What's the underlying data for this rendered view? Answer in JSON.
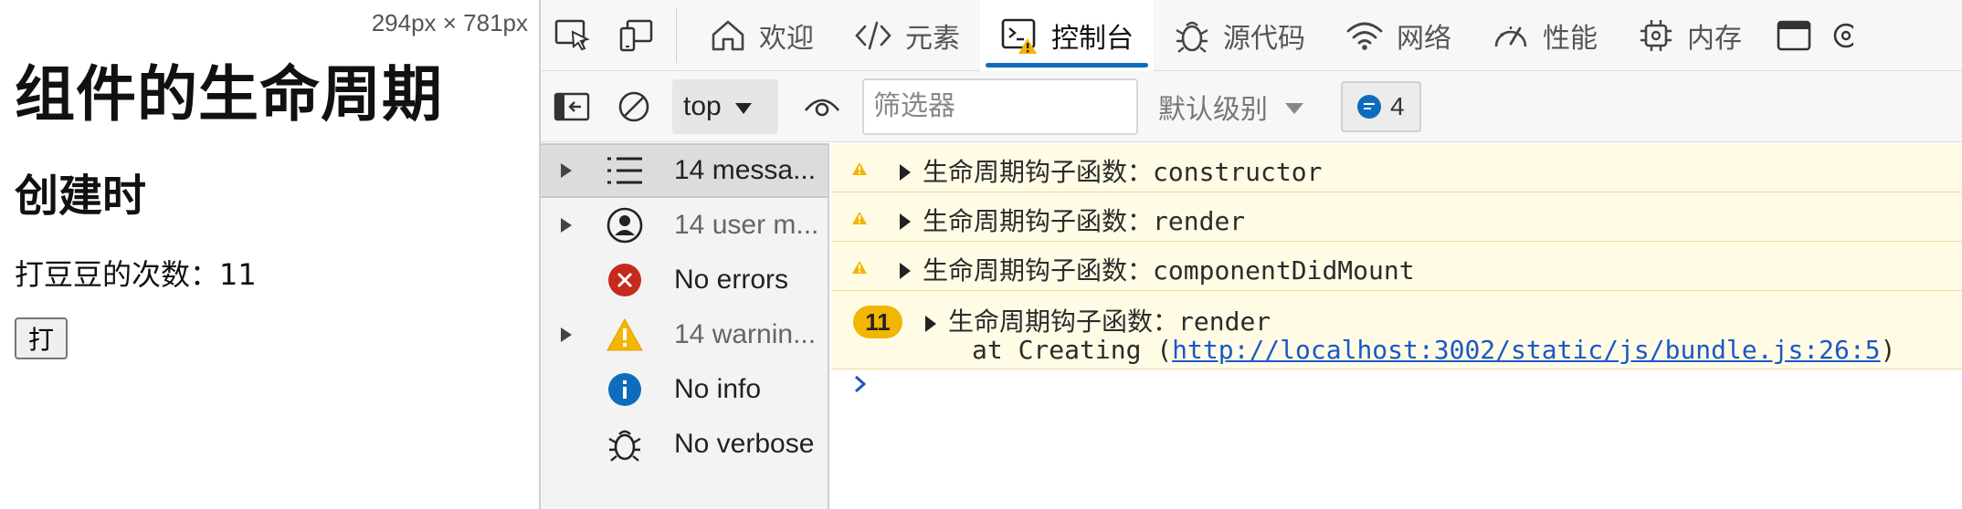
{
  "page": {
    "dimensions": "294px × 781px",
    "title": "组件的生命周期",
    "subtitle": "创建时",
    "count_text": "打豆豆的次数：11",
    "button_label": "打"
  },
  "devtools": {
    "tabs": [
      {
        "label": "欢迎",
        "icon": "home-icon"
      },
      {
        "label": "元素",
        "icon": "code-tag-icon"
      },
      {
        "label": "控制台",
        "icon": "console-icon"
      },
      {
        "label": "源代码",
        "icon": "bug-icon"
      },
      {
        "label": "网络",
        "icon": "wifi-icon"
      },
      {
        "label": "性能",
        "icon": "gauge-icon"
      },
      {
        "label": "内存",
        "icon": "chip-icon"
      }
    ],
    "active_tab": "控制台",
    "toolbar": {
      "context": "top",
      "filter_placeholder": "筛选器",
      "levels": "默认级别",
      "issues_count": "4"
    },
    "sidebar": [
      {
        "label": "14 messa...",
        "icon": "list-icon",
        "expandable": true
      },
      {
        "label": "14 user m...",
        "icon": "user-icon",
        "expandable": true
      },
      {
        "label": "No errors",
        "icon": "error-icon",
        "expandable": false
      },
      {
        "label": "14 warnin...",
        "icon": "warning-icon",
        "expandable": true
      },
      {
        "label": "No info",
        "icon": "info-icon",
        "expandable": false
      },
      {
        "label": "No verbose",
        "icon": "bug-icon",
        "expandable": false
      }
    ],
    "messages": [
      {
        "prefix": "生命周期钩子函数：",
        "value": "constructor"
      },
      {
        "prefix": "生命周期钩子函数：",
        "value": "render"
      },
      {
        "prefix": "生命周期钩子函数：",
        "value": "componentDidMount"
      }
    ],
    "grouped_message": {
      "count": "11",
      "prefix": "生命周期钩子函数：",
      "value": "render",
      "stack_prefix": "at Creating (",
      "stack_link": "http://localhost:3002/static/js/bundle.js:26:5",
      "stack_suffix": ")"
    },
    "colors": {
      "accent": "#0f6cbd",
      "warning_bg": "#fffbe5",
      "warning_icon": "#f2b600",
      "error": "#c42b1c",
      "info": "#0f6cbd"
    }
  }
}
